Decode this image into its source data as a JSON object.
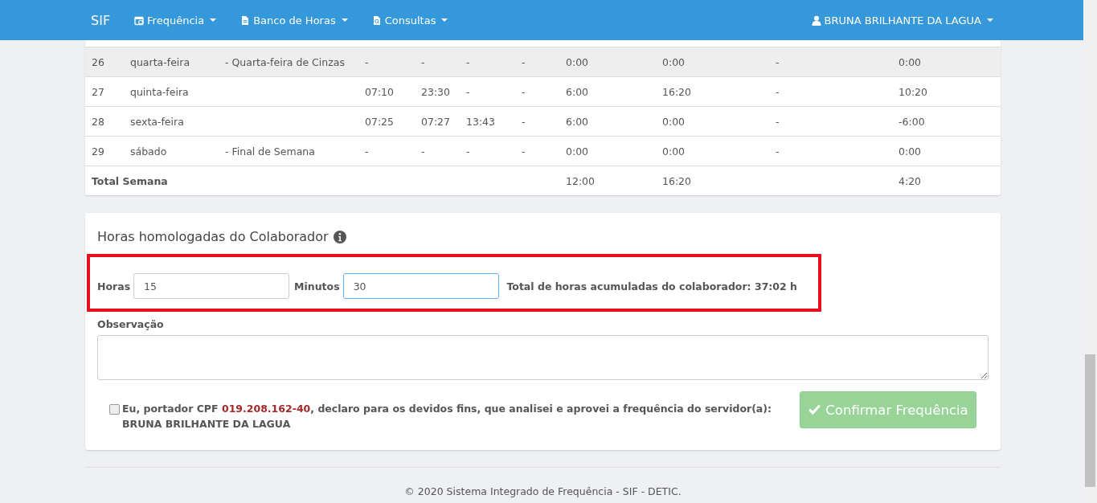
{
  "navbar": {
    "brand": "SIF",
    "menus": [
      {
        "label": "Frequência"
      },
      {
        "label": "Banco de Horas"
      },
      {
        "label": "Consultas"
      }
    ],
    "user": "BRUNA BRILHANTE DA LAGUA"
  },
  "table": {
    "rows": [
      {
        "highlighted": true,
        "cells": [
          "26",
          "quarta-feira",
          "- Quarta-feira de Cinzas",
          "-",
          "-",
          "-",
          "-",
          "0:00",
          "0:00",
          "-",
          "0:00"
        ]
      },
      {
        "highlighted": false,
        "cells": [
          "27",
          "quinta-feira",
          "",
          "07:10",
          "23:30",
          "-",
          "-",
          "6:00",
          "16:20",
          "-",
          "10:20"
        ]
      },
      {
        "highlighted": false,
        "cells": [
          "28",
          "sexta-feira",
          "",
          "07:25",
          "07:27",
          "13:43",
          "-",
          "6:00",
          "0:00",
          "-",
          "-6:00"
        ]
      },
      {
        "highlighted": false,
        "cells": [
          "29",
          "sábado",
          "- Final de Semana",
          "-",
          "-",
          "-",
          "-",
          "0:00",
          "0:00",
          "-",
          "0:00"
        ]
      }
    ],
    "total": {
      "label": "Total Semana",
      "cells": [
        "12:00",
        "16:20",
        "",
        "4:20"
      ]
    }
  },
  "approval": {
    "title": "Horas homologadas do Colaborador",
    "fields": [
      {
        "label": "Horas",
        "value": "15",
        "focused": false
      },
      {
        "label": "Minutos",
        "value": "30",
        "focused": true
      }
    ],
    "accumulated": "Total de horas acumuladas do colaborador: 37:02 h",
    "observation_label": "Observação",
    "declaration": {
      "checked": false,
      "text": "Eu, portador CPF",
      "cpf": "019.208.162-40",
      "rest": ", declaro para os devidos fins, que analisei e aprovei a frequência do servidor(a):",
      "name": "BRUNA BRILHANTE DA LAGUA"
    },
    "confirm_button": {
      "label": "Confirmar Frequência",
      "disabled": true
    }
  },
  "footer": "© 2020 Sistema Integrado de Frequência - SIF - DETIC."
}
